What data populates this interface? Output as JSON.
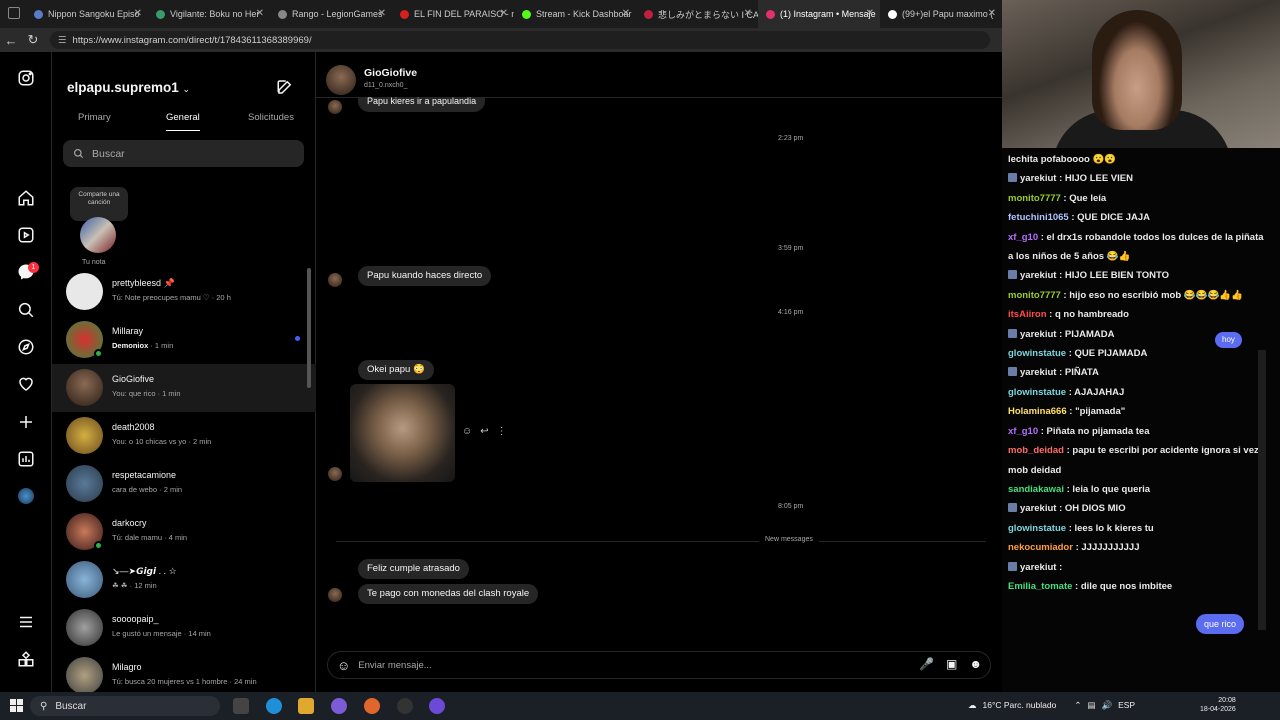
{
  "browser": {
    "tabs": [
      {
        "label": "Nippon Sangoku Episo",
        "color": "#5b7cc8"
      },
      {
        "label": "Vigilante: Boku no Her",
        "color": "#3a9a6a"
      },
      {
        "label": "Rango - LegionGames",
        "color": "#888888"
      },
      {
        "label": "EL FIN DEL PARAISO - n",
        "color": "#d62020"
      },
      {
        "label": "Stream - Kick Dashboar",
        "color": "#53fc18"
      },
      {
        "label": "悲しみがとまらない I CA",
        "color": "#c02040"
      },
      {
        "label": "(1) Instagram • Mensaje",
        "color": "#e1306c"
      },
      {
        "label": "(99+)el Papu maximo (",
        "color": "#ffffff"
      }
    ],
    "url": "https://www.instagram.com/direct/t/17843611368389969/"
  },
  "inbox": {
    "username": "elpapu.supremo1",
    "tabs": [
      "Primary",
      "General",
      "Solicitudes"
    ],
    "search_placeholder": "Buscar",
    "note_bubble": "Comparte una canción",
    "note_label": "Tu nota",
    "conversations": [
      {
        "name": "prettybleesd 📌",
        "meta": "Tú: Note preocupes mamu ♡ · 20 h",
        "online": false,
        "unread": false
      },
      {
        "name": "Millaray",
        "meta_bold": "Demoniox",
        "meta": " · 1 min",
        "online": true,
        "unread": true
      },
      {
        "name": "GioGiofive",
        "meta": "You: que rico · 1 min",
        "online": false,
        "unread": false,
        "selected": true
      },
      {
        "name": "death2008",
        "meta": "You: o 10 chicas vs yo · 2 min",
        "online": false,
        "unread": false
      },
      {
        "name": "respetacamione",
        "meta": "cara de webo · 2 min",
        "online": false,
        "unread": false
      },
      {
        "name": "darkocry",
        "meta": "Tú: dale mamu · 4 min",
        "online": true,
        "unread": false
      },
      {
        "name": "↘—➤𝙂𝙞𝙜𝙞 . . ☆",
        "meta": "☘ ☘ · 12 min",
        "online": false,
        "unread": false
      },
      {
        "name": "soooopaip_",
        "meta": "Le gustó un mensaje · 14 min",
        "online": false,
        "unread": false
      },
      {
        "name": "Milagro",
        "meta": "Tú: busca 20 mujeres vs 1 hombre · 24 min",
        "online": false,
        "unread": false
      }
    ]
  },
  "chat": {
    "contact_name": "GioGiofive",
    "contact_handle": "d11_0.nxch0_",
    "top_partial": "Papu kieres ir a papulandia",
    "ts1": "2:23 pm",
    "ts2": "3:59 pm",
    "msg1": "Papu kuando haces directo",
    "ts3": "4:16 pm",
    "msg2": "Okei papu 😳",
    "ts4": "8:05 pm",
    "new_messages": "New messages",
    "msg3": "Feliz cumple atrasado",
    "msg4": "Te pago con monedas del clash royale",
    "composer_placeholder": "Enviar mensaje..."
  },
  "stream_chat": [
    {
      "user": "",
      "text": "lechita pofaboooo 😮😮",
      "color": "#eaeaea"
    },
    {
      "user": "yarekiut",
      "text": " : HIJO LEE VIEN",
      "color": "#eaeaea"
    },
    {
      "user": "monito7777",
      "text": " : Que leía",
      "color": "#9acd32"
    },
    {
      "user": "fetuchini1065",
      "text": " : QUE DICE JAJA",
      "color": "#b0c4ff"
    },
    {
      "user": "xf_g10",
      "text": " : el drx1s robandole todos los dulces de la piñata",
      "color": "#b56cff"
    },
    {
      "user": "",
      "text": "a los niños de 5 años 😂👍",
      "color": "#eaeaea"
    },
    {
      "user": "yarekiut",
      "text": " : HIJO LEE BIEN TONTO",
      "color": "#eaeaea"
    },
    {
      "user": "monito7777",
      "text": " : hijo eso no escribió mob 😂😂😂👍👍",
      "color": "#9acd32"
    },
    {
      "user": "itsAiiron",
      "text": " : q no hambreado",
      "color": "#ff4b4b"
    },
    {
      "user": "yarekiut",
      "text": " : PIJAMADA",
      "color": "#eaeaea"
    },
    {
      "user": "glowinstatue",
      "text": " : QUE PIJAMADA",
      "color": "#7ed6df"
    },
    {
      "user": "yarekiut",
      "text": " : PIÑATA",
      "color": "#eaeaea"
    },
    {
      "user": "glowinstatue",
      "text": " : AJAJAHAJ",
      "color": "#7ed6df"
    },
    {
      "user": "Holamina666",
      "text": " : \"pijamada\"",
      "color": "#ffe066"
    },
    {
      "user": "xf_g10",
      "text": " : Piñata no pijamada tea",
      "color": "#b56cff"
    },
    {
      "user": "mob_deidad",
      "text": " : papu te escribi por acidente ignora si vez",
      "color": "#ff6b6b"
    },
    {
      "user": "",
      "text": "mob deidad",
      "color": "#eaeaea"
    },
    {
      "user": "sandiakawai",
      "text": " : leia lo que queria",
      "color": "#4ade80"
    },
    {
      "user": "yarekiut",
      "text": " : OH DIOS MIO",
      "color": "#eaeaea"
    },
    {
      "user": "glowinstatue",
      "text": " : lees lo k kieres tu",
      "color": "#7ed6df"
    },
    {
      "user": "nekocumiador",
      "text": " : JJJJJJJJJJJ",
      "color": "#ff9f43"
    },
    {
      "user": "yarekiut",
      "text": " : ",
      "color": "#eaeaea"
    },
    {
      "user": "Emilia_tomate",
      "text": " : dile que nos imbitee",
      "color": "#4ade80"
    }
  ],
  "stream_pills": {
    "hoy": "hoy",
    "queri": "que rico"
  },
  "taskbar": {
    "search": "Buscar",
    "weather": "16°C  Parc. nublado",
    "lang": "ESP",
    "time": "20:08",
    "date": "18-04-2026"
  }
}
